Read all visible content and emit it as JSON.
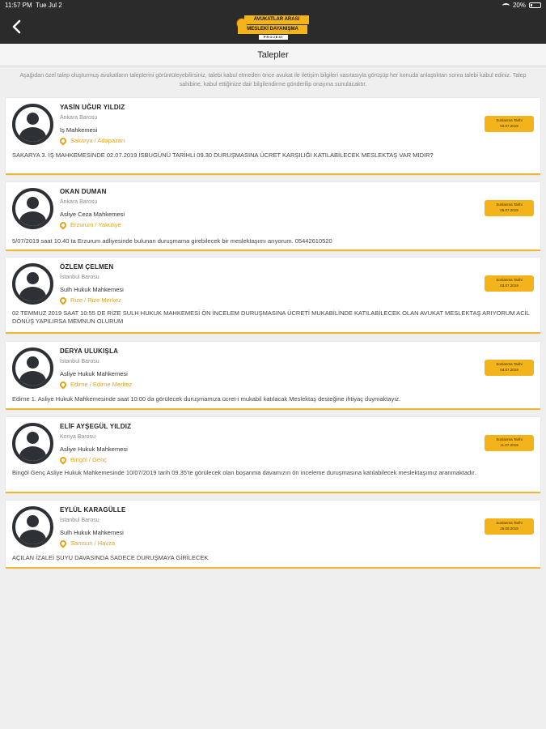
{
  "status": {
    "time": "11:57 PM",
    "date": "Tue Jul 2",
    "battery": "20%"
  },
  "logo": {
    "line1": "AVUKATLAR ARASI",
    "line2": "MESLEKİ DAYANIŞMA",
    "line3": "PROJESİ"
  },
  "page": {
    "title": "Talepler",
    "info": "Aşağıdan özel talep oluşturmuş avukatların taleplerini görüntüleyebilirsiniz, talebi kabul etmeden önce avukat ile iletişim bilgileri vasıtasıyla görüşüp her konuda anlaştıktan sonra talebi kabul ediniz. Talep sahibine, kabul ettiğinize dair bilgilendirme gönderilip onayına sunulacaktır."
  },
  "requests": [
    {
      "name": "YASİN UĞUR YILDIZ",
      "baro": "Ankara Barosu",
      "court": "İş Mahkemesi",
      "location": "Sakarya / Adapazarı",
      "badge_label": "Sonlanma Tarihi",
      "badge_date": "02.07.2019",
      "description": "SAKARYA 3. İŞ MAHKEMESİNDE 02.07.2019 İSBUGÜNÜ TARİHLİ 09.30 DURUŞMASINA ÜCRET KARŞILIĞI KATILABİLECEK MESLEKTAŞ VAR MIDIR?"
    },
    {
      "name": "OKAN DUMAN",
      "baro": "Ankara Barosu",
      "court": "Asliye Ceza Mahkemesi",
      "location": "Erzurum / Yakutiye",
      "badge_label": "Sonlanma Tarihi",
      "badge_date": "05.07.2019",
      "description": "5/07/2019 saat 10.40 ta Erzurum adliyesinde bulunan duruşmama girebilecek bir meslektaşımı arıyorum. 05442610520"
    },
    {
      "name": "ÖZLEM ÇELMEN",
      "baro": "İstanbul Barosu",
      "court": "Sulh Hukuk Mahkemesi",
      "location": "Rize / Rize Merkez",
      "badge_label": "Sonlanma Tarihi",
      "badge_date": "03.07.2019",
      "description": "02 TEMMUZ 2019 SAAT 10:55 DE RİZE SULH HUKUK MAHKEMESİ ÖN İNCELEM DURUŞMASINA ÜCRETİ MUKABİLİNDE KATILABİLECEK OLAN AVUKAT MESLEKTAŞ ARIYORUM ACİL DÖNÜŞ YAPILIRSA MEMNUN OLURUM"
    },
    {
      "name": "DERYA ULUKIŞLA",
      "baro": "İstanbul Barosu",
      "court": "Asliye Hukuk Mahkemesi",
      "location": "Edirne / Edirne Merkez",
      "badge_label": "Sonlanma Tarihi",
      "badge_date": "04.07.2019",
      "description": "Edirne 1. Asliye Hukuk Mahkemesinde saat 10:00 da görülecek duruşmamıza ücret-i mukabil katılacak Meslektaş desteğine ihtiyaç duymaktayız."
    },
    {
      "name": "ELİF AYŞEGÜL YILDIZ",
      "baro": "Konya Barosu",
      "court": "Asliye Hukuk Mahkemesi",
      "location": "Bingöl / Genç",
      "badge_label": "Sonlanma Tarihi",
      "badge_date": "11.07.2019",
      "description": "Bingöl Genç Asliye Hukuk Mahkemesinde 10/07/2019 tarih 09.35'te görülecek olan boşanma davamızın ön inceleme duruşmasına katılabilecek meslektaşımız aranmaktadır."
    },
    {
      "name": "EYLÜL KARAGÜLLE",
      "baro": "İstanbul Barosu",
      "court": "Sulh Hukuk Mahkemesi",
      "location": "Samsun / Havza",
      "badge_label": "Sonlanma Tarihi",
      "badge_date": "26.09.2019",
      "description": "AÇILAN İZALEİ ŞUYU DAVASINDA SADECE DURUŞMAYA GİRİLECEK"
    }
  ]
}
